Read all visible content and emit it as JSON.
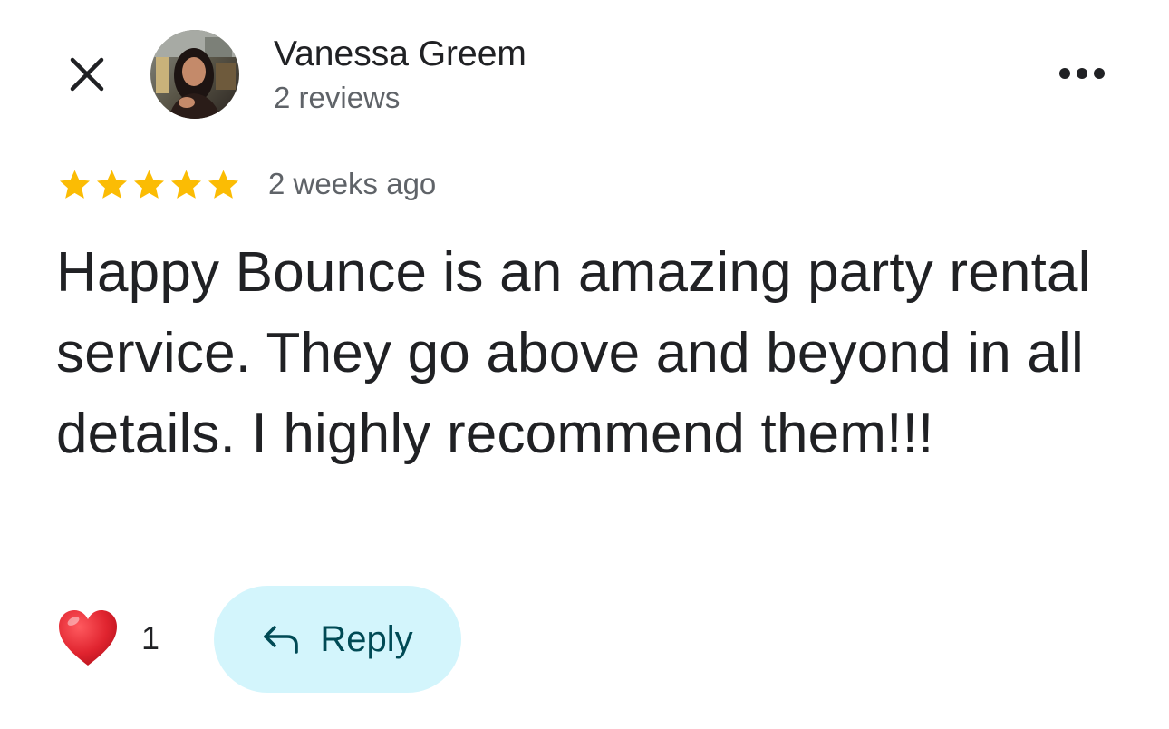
{
  "header": {
    "author_name": "Vanessa Greem",
    "author_reviews": "2 reviews",
    "close_icon": "close-icon",
    "more_icon": "more-horizontal-icon"
  },
  "review": {
    "rating": 5,
    "rating_max": 5,
    "time_ago": "2 weeks ago",
    "text": "Happy Bounce is an amazing party rental service. They go above and beyond in all details. I highly recommend them!!!"
  },
  "actions": {
    "like_icon": "heart-icon",
    "like_count": "1",
    "reply_label": "Reply",
    "reply_icon": "reply-arrow-icon"
  },
  "colors": {
    "star": "#fbbc04",
    "reply_bg": "#d3f5fc",
    "reply_text": "#004a55",
    "heart": "#e0242f",
    "secondary_text": "#5f6368"
  }
}
